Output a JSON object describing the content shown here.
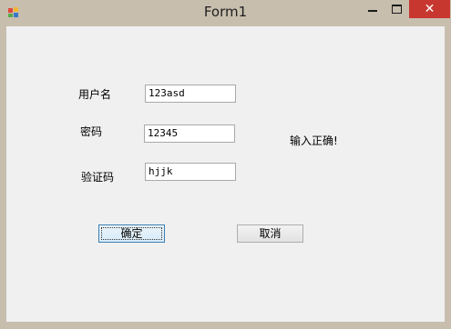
{
  "window": {
    "title": "Form1",
    "close_glyph": "✕"
  },
  "form": {
    "username_label": "用户名",
    "username_value": "123asd",
    "password_label": "密码",
    "password_value": "12345",
    "captcha_label": "验证码",
    "captcha_value": "hjjk",
    "status_text": "输入正确!",
    "ok_button": "确定",
    "cancel_button": "取消"
  }
}
